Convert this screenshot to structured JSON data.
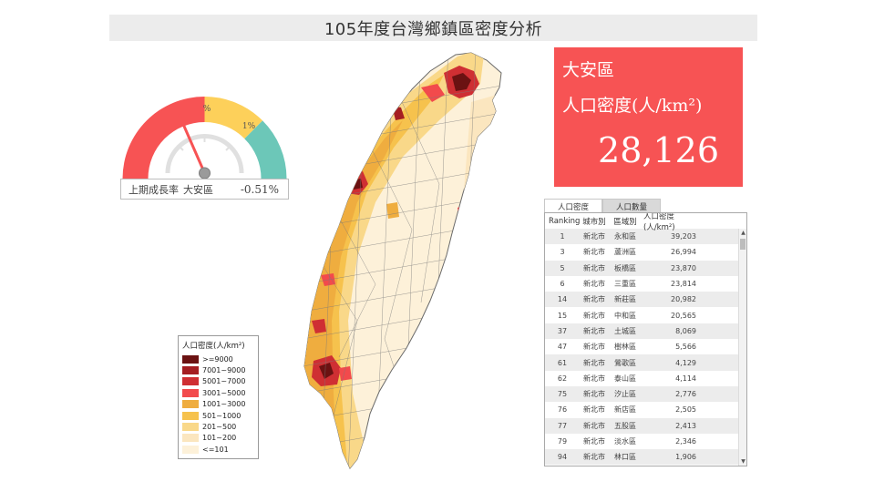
{
  "title": "105年度台灣鄉鎮區密度分析",
  "gauge": {
    "tick_percent": "%",
    "tick_one_percent": "1%",
    "footer_label": "上期成長率",
    "footer_district": "大安區",
    "footer_value": "-0.51%",
    "growth_rate_percent": -0.51,
    "colors": {
      "red": "#f75354",
      "yellow": "#fdd05a",
      "teal": "#6cc7b8",
      "needle": "#f75354",
      "hub": "#9a9a9a"
    }
  },
  "legend": {
    "title": "人口密度(人/km²)",
    "items": [
      {
        "label": ">=9000",
        "color": "#6b1212"
      },
      {
        "label": "7001~9000",
        "color": "#a51e22"
      },
      {
        "label": "5001~7000",
        "color": "#cf2f33"
      },
      {
        "label": "3001~5000",
        "color": "#f24a4c"
      },
      {
        "label": "1001~3000",
        "color": "#efad3f"
      },
      {
        "label": "501~1000",
        "color": "#f6c24d"
      },
      {
        "label": "201~500",
        "color": "#f9d889"
      },
      {
        "label": "101~200",
        "color": "#fbe6bf"
      },
      {
        "label": "<=101",
        "color": "#fdf1d9"
      }
    ]
  },
  "kpi": {
    "district": "大安區",
    "metric": "人口密度(人/km²)",
    "value": "28,126",
    "background": "#f75354"
  },
  "tabs": [
    {
      "label": "人口密度",
      "active": true
    },
    {
      "label": "人口數量",
      "active": false
    }
  ],
  "table": {
    "headers": [
      "Ranking",
      "城市別",
      "區域別",
      "人口密度(人/km²)"
    ],
    "rows": [
      {
        "rank": "1",
        "city": "新北市",
        "district": "永和區",
        "value": "39,203"
      },
      {
        "rank": "3",
        "city": "新北市",
        "district": "蘆洲區",
        "value": "26,994"
      },
      {
        "rank": "5",
        "city": "新北市",
        "district": "板橋區",
        "value": "23,870"
      },
      {
        "rank": "6",
        "city": "新北市",
        "district": "三重區",
        "value": "23,814"
      },
      {
        "rank": "14",
        "city": "新北市",
        "district": "新莊區",
        "value": "20,982"
      },
      {
        "rank": "15",
        "city": "新北市",
        "district": "中和區",
        "value": "20,565"
      },
      {
        "rank": "37",
        "city": "新北市",
        "district": "土城區",
        "value": "8,069"
      },
      {
        "rank": "47",
        "city": "新北市",
        "district": "樹林區",
        "value": "5,566"
      },
      {
        "rank": "61",
        "city": "新北市",
        "district": "鶯歌區",
        "value": "4,129"
      },
      {
        "rank": "62",
        "city": "新北市",
        "district": "泰山區",
        "value": "4,114"
      },
      {
        "rank": "75",
        "city": "新北市",
        "district": "汐止區",
        "value": "2,776"
      },
      {
        "rank": "76",
        "city": "新北市",
        "district": "新店區",
        "value": "2,505"
      },
      {
        "rank": "77",
        "city": "新北市",
        "district": "五股區",
        "value": "2,413"
      },
      {
        "rank": "79",
        "city": "新北市",
        "district": "淡水區",
        "value": "2,346"
      },
      {
        "rank": "94",
        "city": "新北市",
        "district": "林口區",
        "value": "1,906"
      }
    ]
  }
}
